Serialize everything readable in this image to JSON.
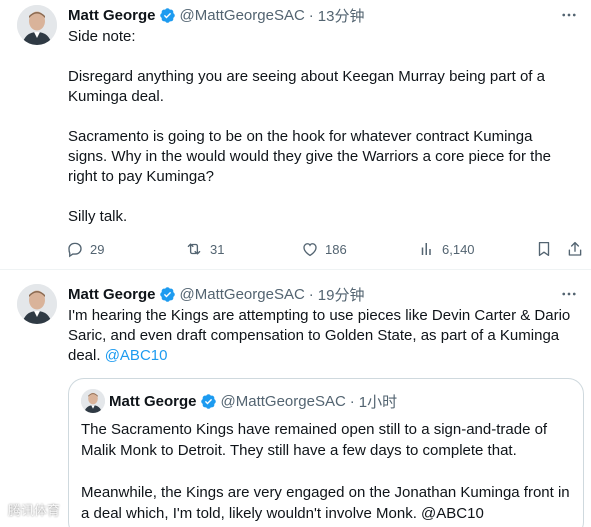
{
  "tweets": [
    {
      "author": {
        "name": "Matt George",
        "handle": "@MattGeorgeSAC"
      },
      "separator": "·",
      "time": "13分钟",
      "paragraphs": [
        "Side note:",
        "Disregard anything you are seeing about Keegan Murray being part of a Kuminga deal.",
        "Sacramento is going to be on the hook for whatever contract Kuminga signs. Why in the would would they give the Warriors a core piece for the right to pay Kuminga?",
        "Silly talk."
      ],
      "actions": {
        "replies": "29",
        "retweets": "31",
        "likes": "186",
        "views": "6,140"
      }
    },
    {
      "author": {
        "name": "Matt George",
        "handle": "@MattGeorgeSAC"
      },
      "separator": "·",
      "time": "19分钟",
      "text": "I'm hearing the Kings are attempting to use pieces like Devin Carter & Dario Saric, and even draft compensation to Golden State, as part of a Kuminga deal.",
      "mention": "@ABC10",
      "quote": {
        "author": {
          "name": "Matt George",
          "handle": "@MattGeorgeSAC"
        },
        "separator": "·",
        "time": "1小时",
        "paragraphs": [
          "The Sacramento Kings have remained open still to a sign-and-trade of Malik Monk to Detroit. They still have a few days to complete that.",
          "Meanwhile, the Kings are very engaged on the Jonathan Kuminga front in a deal which, I'm told, likely wouldn't involve Monk. @ABC10"
        ]
      }
    }
  ],
  "watermark": "腾讯体育",
  "colors": {
    "text": "#0f1419",
    "secondary": "#536471",
    "accent": "#1d9bf0",
    "border": "#cfd9de",
    "divider": "#eff3f4"
  },
  "icons": [
    "verified-badge-icon",
    "more-icon",
    "reply-icon",
    "retweet-icon",
    "like-icon",
    "views-icon",
    "bookmark-icon",
    "share-icon"
  ]
}
